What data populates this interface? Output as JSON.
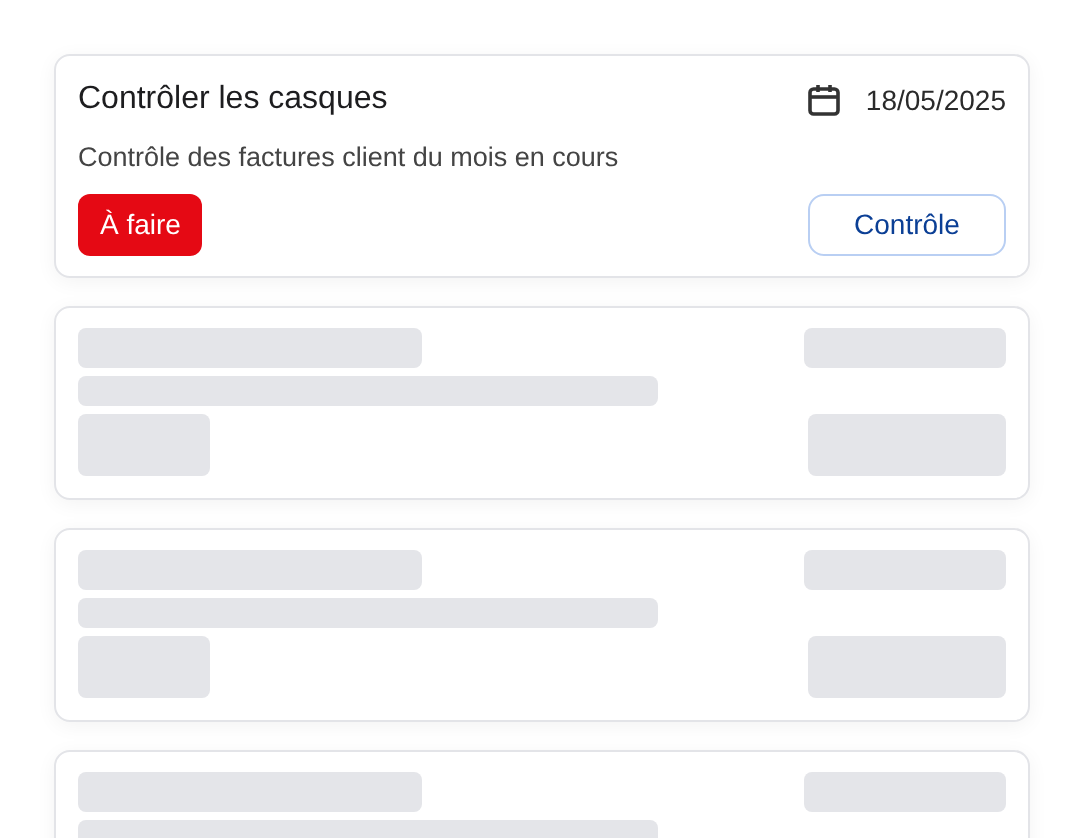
{
  "task": {
    "title": "Contrôler les casques",
    "date": "18/05/2025",
    "description": "Contrôle des factures client du mois en cours",
    "status": {
      "label": "À faire",
      "kind": "todo"
    },
    "action_button": "Contrôle"
  }
}
